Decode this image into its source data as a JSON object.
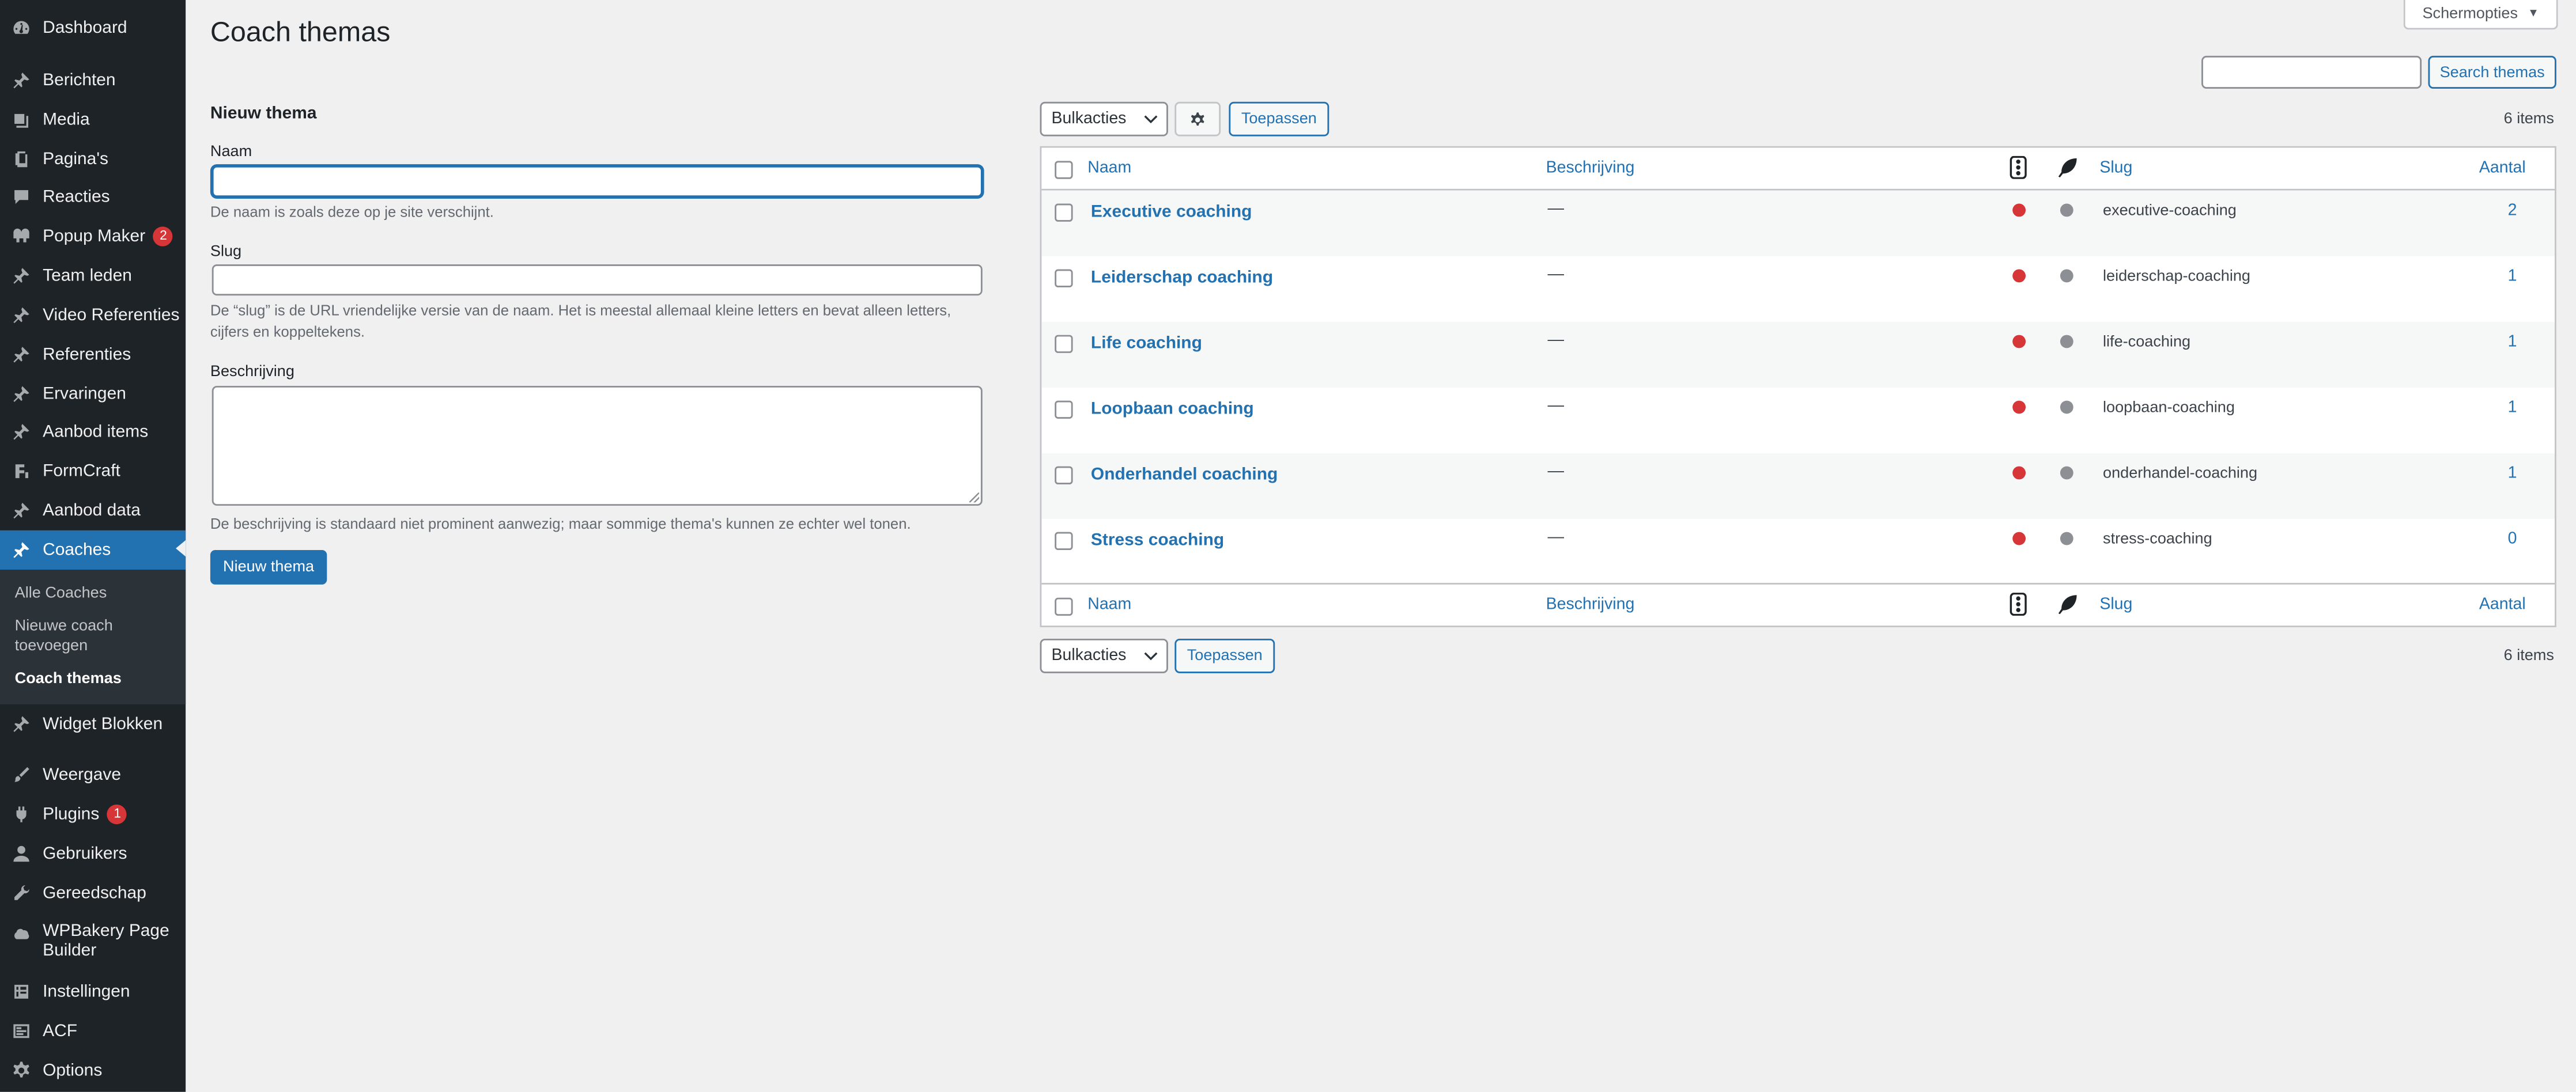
{
  "sidebar": {
    "items": [
      {
        "label": "Dashboard",
        "icon": "dashboard-icon"
      },
      {
        "label": "Berichten",
        "icon": "pin-icon"
      },
      {
        "label": "Media",
        "icon": "media-icon"
      },
      {
        "label": "Pagina's",
        "icon": "page-icon"
      },
      {
        "label": "Reacties",
        "icon": "comment-icon"
      },
      {
        "label": "Popup Maker",
        "icon": "popup-icon",
        "badge": "2"
      },
      {
        "label": "Team leden",
        "icon": "pin-icon"
      },
      {
        "label": "Video Referenties",
        "icon": "pin-icon"
      },
      {
        "label": "Referenties",
        "icon": "pin-icon"
      },
      {
        "label": "Ervaringen",
        "icon": "pin-icon"
      },
      {
        "label": "Aanbod items",
        "icon": "pin-icon"
      },
      {
        "label": "FormCraft",
        "icon": "formcraft-icon"
      },
      {
        "label": "Aanbod data",
        "icon": "pin-icon"
      },
      {
        "label": "Coaches",
        "icon": "pin-icon"
      },
      {
        "label": "Widget Blokken",
        "icon": "pin-icon"
      },
      {
        "label": "Weergave",
        "icon": "brush-icon"
      },
      {
        "label": "Plugins",
        "icon": "plugin-icon",
        "badge": "1"
      },
      {
        "label": "Gebruikers",
        "icon": "user-icon"
      },
      {
        "label": "Gereedschap",
        "icon": "wrench-icon"
      },
      {
        "label": "WPBakery Page Builder",
        "icon": "wpbakery-icon"
      },
      {
        "label": "Instellingen",
        "icon": "settings-icon"
      },
      {
        "label": "ACF",
        "icon": "acf-icon"
      },
      {
        "label": "Options",
        "icon": "gear-icon"
      }
    ],
    "submenu": [
      "Alle Coaches",
      "Nieuwe coach toevoegen",
      "Coach themas"
    ]
  },
  "header": {
    "title": "Coach themas",
    "screen_options": "Schermopties"
  },
  "form": {
    "heading": "Nieuw thema",
    "name_label": "Naam",
    "name_help": "De naam is zoals deze op je site verschijnt.",
    "slug_label": "Slug",
    "slug_help": "De “slug” is de URL vriendelijke versie van de naam. Het is meestal allemaal kleine letters en bevat alleen letters, cijfers en koppeltekens.",
    "description_label": "Beschrijving",
    "description_help": "De beschrijving is standaard niet prominent aanwezig; maar sommige thema's kunnen ze echter wel tonen.",
    "submit": "Nieuw thema"
  },
  "list": {
    "search_button": "Search themas",
    "bulk_label": "Bulkacties",
    "apply_label": "Toepassen",
    "items_count": "6 items",
    "columns": {
      "name": "Naam",
      "description": "Beschrijving",
      "slug": "Slug",
      "count": "Aantal"
    },
    "rows": [
      {
        "name": "Executive coaching",
        "description": "—",
        "slug": "executive-coaching",
        "count": "2"
      },
      {
        "name": "Leiderschap coaching",
        "description": "—",
        "slug": "leiderschap-coaching",
        "count": "1"
      },
      {
        "name": "Life coaching",
        "description": "—",
        "slug": "life-coaching",
        "count": "1"
      },
      {
        "name": "Loopbaan coaching",
        "description": "—",
        "slug": "loopbaan-coaching",
        "count": "1"
      },
      {
        "name": "Onderhandel coaching",
        "description": "—",
        "slug": "onderhandel-coaching",
        "count": "1"
      },
      {
        "name": "Stress coaching",
        "description": "—",
        "slug": "stress-coaching",
        "count": "0"
      }
    ]
  },
  "colors": {
    "accent": "#2271b1",
    "sidebar_bg": "#1d2327",
    "status_red": "#d63638",
    "status_grey": "#8c8f94"
  }
}
